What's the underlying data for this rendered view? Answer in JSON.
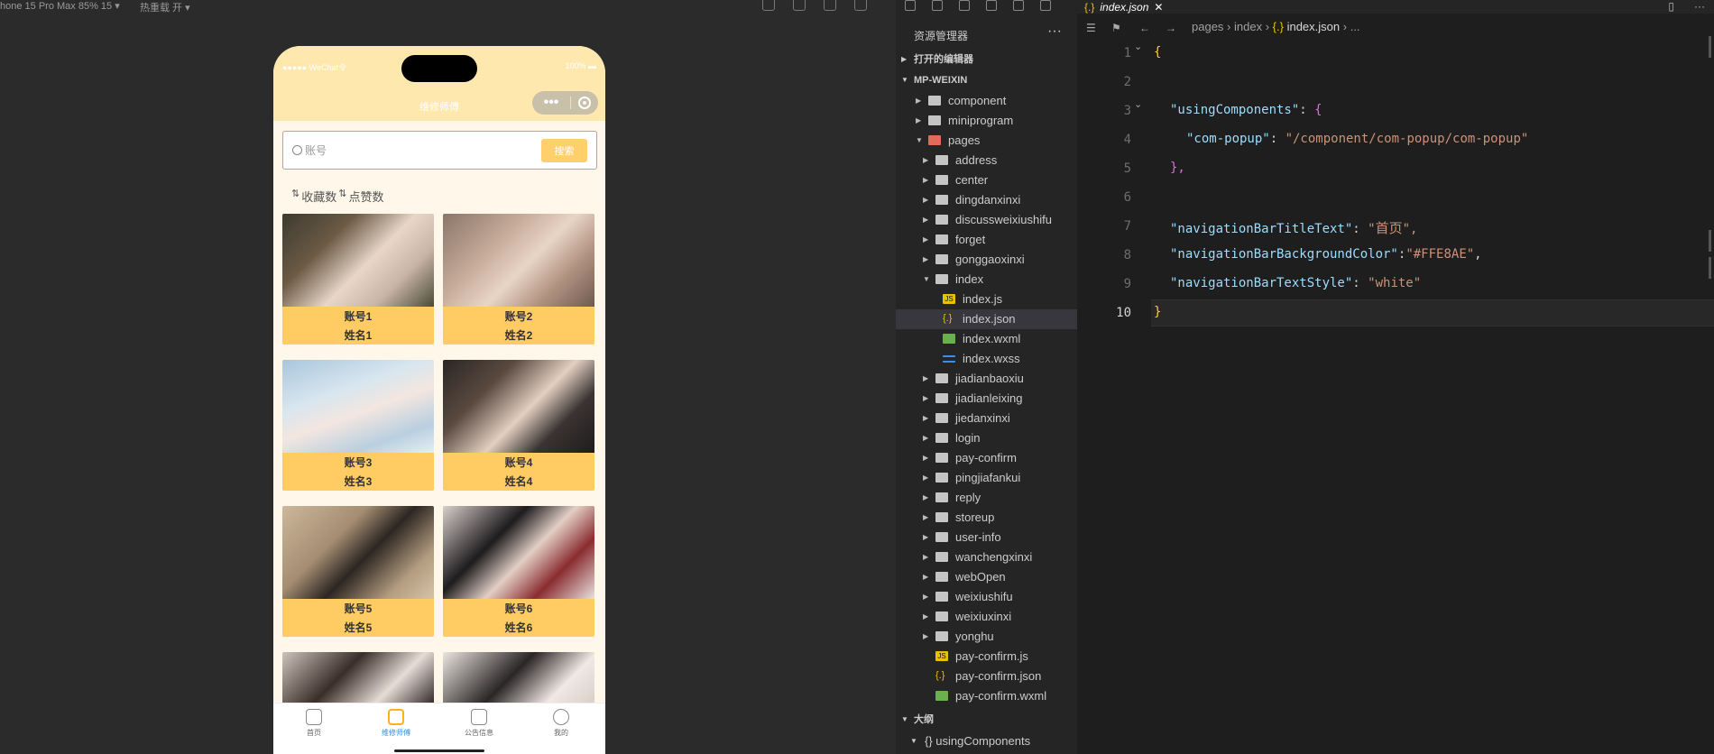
{
  "simulator": {
    "device_label": "hone 15 Pro Max 85% 15 ▾",
    "reload_label": "热重载 开 ▾",
    "status_left": "●●●●● WeChat令",
    "status_right": "100% ▬",
    "nav_title": "维修师傅",
    "capsule_more": "•••",
    "search_placeholder": "账号",
    "search_button": "搜索",
    "sort_favorites": "收藏数",
    "sort_likes": "点赞数",
    "sort_arrows": "⇅",
    "cards": [
      {
        "account": "账号1",
        "name": "姓名1"
      },
      {
        "account": "账号2",
        "name": "姓名2"
      },
      {
        "account": "账号3",
        "name": "姓名3"
      },
      {
        "account": "账号4",
        "name": "姓名4"
      },
      {
        "account": "账号5",
        "name": "姓名5"
      },
      {
        "account": "账号6",
        "name": "姓名6"
      }
    ],
    "tabs": [
      {
        "label": "首页",
        "icon": "home-icon"
      },
      {
        "label": "维修师傅",
        "icon": "grid-icon"
      },
      {
        "label": "公告信息",
        "icon": "notice-icon"
      },
      {
        "label": "我的",
        "icon": "user-icon"
      }
    ],
    "active_tab_color": "#2b8ee8",
    "nav_color": "#FFE8AE"
  },
  "explorer": {
    "title": "资源管理器",
    "more": "···",
    "open_editors": "打开的编辑器",
    "project": "MP-WEIXIN",
    "tree": [
      {
        "label": "component",
        "type": "folder",
        "depth": 1,
        "expanded": false
      },
      {
        "label": "miniprogram",
        "type": "folder",
        "depth": 1,
        "expanded": false
      },
      {
        "label": "pages",
        "type": "folder-red",
        "depth": 1,
        "expanded": true
      },
      {
        "label": "address",
        "type": "folder",
        "depth": 2,
        "expanded": false
      },
      {
        "label": "center",
        "type": "folder",
        "depth": 2,
        "expanded": false
      },
      {
        "label": "dingdanxinxi",
        "type": "folder",
        "depth": 2,
        "expanded": false
      },
      {
        "label": "discussweixiushifu",
        "type": "folder",
        "depth": 2,
        "expanded": false
      },
      {
        "label": "forget",
        "type": "folder",
        "depth": 2,
        "expanded": false
      },
      {
        "label": "gonggaoxinxi",
        "type": "folder",
        "depth": 2,
        "expanded": false
      },
      {
        "label": "index",
        "type": "folder",
        "depth": 2,
        "expanded": true
      },
      {
        "label": "index.js",
        "type": "js",
        "depth": 3
      },
      {
        "label": "index.json",
        "type": "json",
        "depth": 3,
        "selected": true
      },
      {
        "label": "index.wxml",
        "type": "wxml",
        "depth": 3
      },
      {
        "label": "index.wxss",
        "type": "wxss",
        "depth": 3
      },
      {
        "label": "jiadianbaoxiu",
        "type": "folder",
        "depth": 2,
        "expanded": false
      },
      {
        "label": "jiadianleixing",
        "type": "folder",
        "depth": 2,
        "expanded": false
      },
      {
        "label": "jiedanxinxi",
        "type": "folder",
        "depth": 2,
        "expanded": false
      },
      {
        "label": "login",
        "type": "folder",
        "depth": 2,
        "expanded": false
      },
      {
        "label": "pay-confirm",
        "type": "folder",
        "depth": 2,
        "expanded": false
      },
      {
        "label": "pingjiafankui",
        "type": "folder",
        "depth": 2,
        "expanded": false
      },
      {
        "label": "reply",
        "type": "folder",
        "depth": 2,
        "expanded": false
      },
      {
        "label": "storeup",
        "type": "folder",
        "depth": 2,
        "expanded": false
      },
      {
        "label": "user-info",
        "type": "folder",
        "depth": 2,
        "expanded": false
      },
      {
        "label": "wanchengxinxi",
        "type": "folder",
        "depth": 2,
        "expanded": false
      },
      {
        "label": "webOpen",
        "type": "folder",
        "depth": 2,
        "expanded": false
      },
      {
        "label": "weixiushifu",
        "type": "folder",
        "depth": 2,
        "expanded": false
      },
      {
        "label": "weixiuxinxi",
        "type": "folder",
        "depth": 2,
        "expanded": false
      },
      {
        "label": "yonghu",
        "type": "folder",
        "depth": 2,
        "expanded": false
      },
      {
        "label": "pay-confirm.js",
        "type": "js",
        "depth": 2
      },
      {
        "label": "pay-confirm.json",
        "type": "json",
        "depth": 2
      },
      {
        "label": "pay-confirm.wxml",
        "type": "wxml",
        "depth": 2
      }
    ],
    "outline_title": "大纲",
    "outline_item": "{} usingComponents"
  },
  "editor": {
    "tab_label": "index.json",
    "tab_icon": "{.}",
    "tab_close": "✕",
    "breadcrumb": {
      "part1": "pages",
      "part2": "index",
      "icon": "{.}",
      "file": "index.json",
      "rest": "..."
    },
    "line_numbers": [
      "1",
      "2",
      "3",
      "4",
      "5",
      "6",
      "7",
      "8",
      "9",
      "10"
    ],
    "code": {
      "l1_brace": "{",
      "l3_key": "\"usingComponents\"",
      "l3_colon": ": ",
      "l3_brace": "{",
      "l4_key": "\"com-popup\"",
      "l4_colon": ": ",
      "l4_val": "\"/component/com-popup/com-popup\"",
      "l5_brace": "},",
      "l7_key": "\"navigationBarTitleText\"",
      "l7_colon": ": ",
      "l7_q1": "\"",
      "l7_val": "首页",
      "l7_q2": "\",",
      "l8_key": "\"navigationBarBackgroundColor\"",
      "l8_colon": ":",
      "l8_val": "\"#FFE8AE\"",
      "l8_comma": ",",
      "l9_key": "\"navigationBarTextStyle\"",
      "l9_colon": ": ",
      "l9_val": "\"white\"",
      "l10_brace": "}"
    }
  }
}
